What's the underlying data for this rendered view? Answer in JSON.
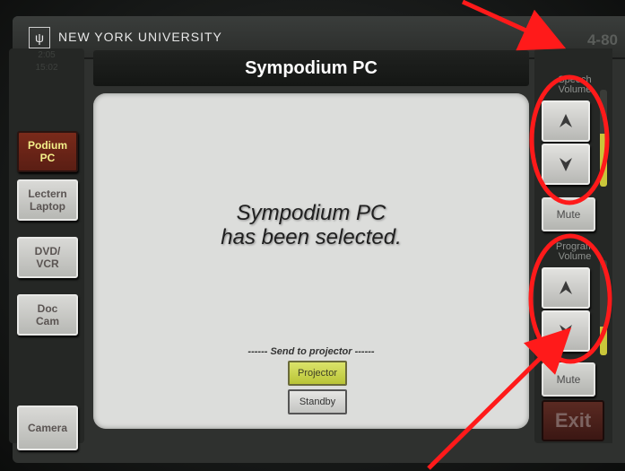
{
  "header": {
    "logo_glyph": "ψ",
    "university": "NEW YORK UNIVERSITY",
    "room": "4-80"
  },
  "left_panel": {
    "clock": [
      "2:05",
      "15:02"
    ],
    "sources": [
      {
        "label_line1": "Podium",
        "label_line2": "PC",
        "active": true
      },
      {
        "label_line1": "Lectern",
        "label_line2": "Laptop",
        "active": false
      },
      {
        "label_line1": "DVD/",
        "label_line2": "VCR",
        "active": false
      },
      {
        "label_line1": "Doc",
        "label_line2": "Cam",
        "active": false
      }
    ],
    "camera_label": "Camera"
  },
  "main": {
    "title": "Sympodium PC",
    "selected_line1": "Sympodium PC",
    "selected_line2": "has been selected.",
    "send_label": "------ Send to projector ------",
    "projector_label": "Projector",
    "standby_label": "Standby"
  },
  "right_panel": {
    "speech_volume": {
      "label_line1": "Speech",
      "label_line2": "Volume",
      "up_icon": "arrow-up-icon",
      "down_icon": "arrow-down-icon",
      "mute_label": "Mute",
      "level": 0.55
    },
    "program_volume": {
      "label_line1": "Program",
      "label_line2": "Volume",
      "up_icon": "arrow-up-icon",
      "down_icon": "arrow-down-icon",
      "mute_label": "Mute",
      "level": 0.3
    },
    "exit_label": "Exit"
  },
  "colors": {
    "active_source": "#6b2418",
    "active_text": "#f3f08a",
    "projector_on": "#c9d24a",
    "annotation": "#ff1a1a"
  }
}
